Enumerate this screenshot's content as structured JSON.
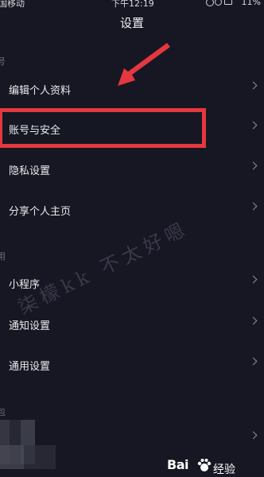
{
  "status_bar": {
    "carrier": "国移动",
    "time": "下午12:19",
    "battery_text": "11%"
  },
  "header": {
    "title": "设置"
  },
  "sections": [
    {
      "header": "号"
    },
    {
      "header": "用"
    },
    {
      "header": "包"
    }
  ],
  "account_items": [
    {
      "label": "编辑个人资料"
    },
    {
      "label": "账号与安全"
    },
    {
      "label": "隐私设置"
    },
    {
      "label": "分享个人主页"
    }
  ],
  "general_items": [
    {
      "label": "小程序"
    },
    {
      "label": "通知设置"
    },
    {
      "label": "通用设置"
    }
  ],
  "watermark": {
    "text": "柒檬kk 不太好嗯"
  },
  "branding": {
    "logo_text": "Bai",
    "logo_suffix": "经验"
  },
  "colors": {
    "background": "#161722",
    "highlight": "#e4373f",
    "text": "#ebebef"
  },
  "icons": {
    "chevron": "chevron-right-icon",
    "arrow": "red-arrow-annotation"
  }
}
